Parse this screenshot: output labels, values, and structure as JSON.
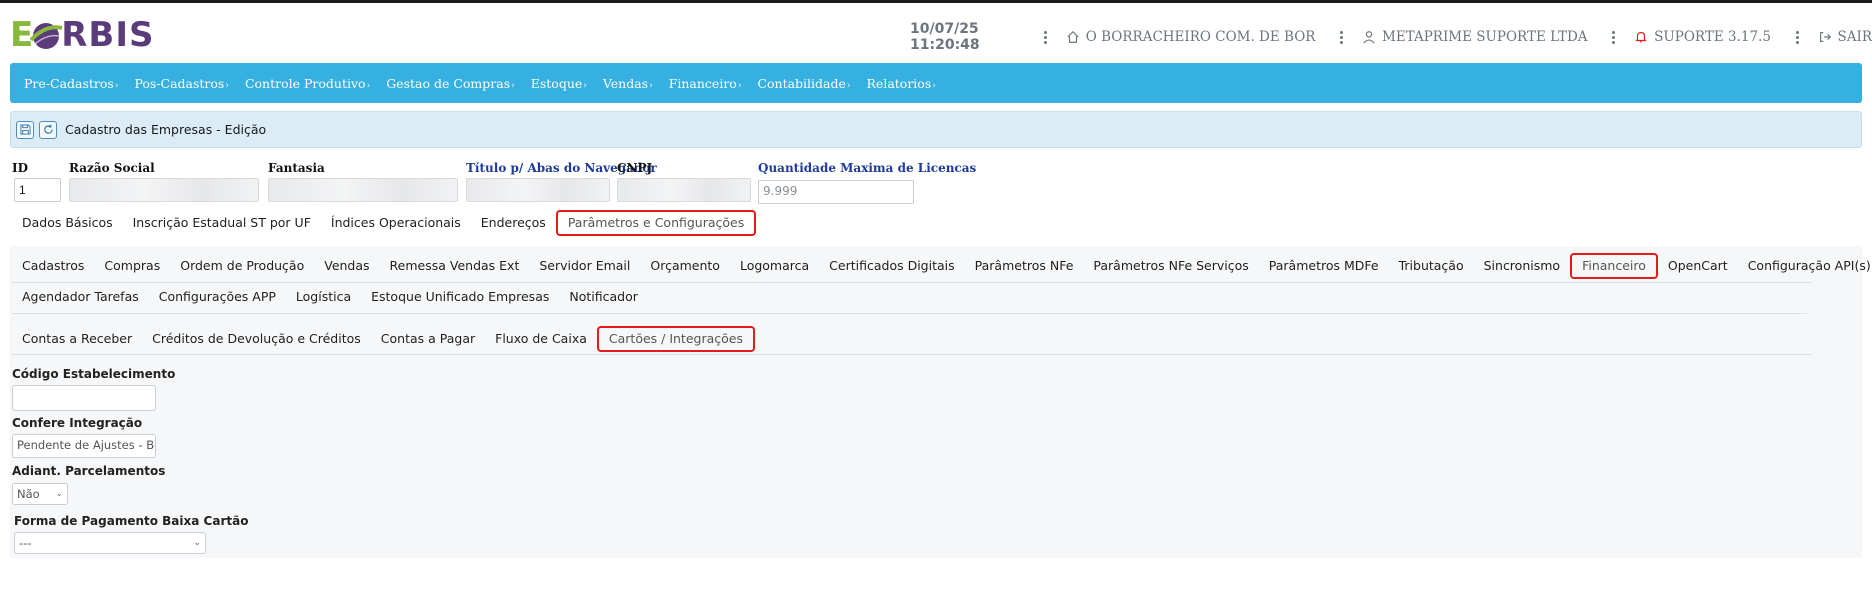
{
  "header": {
    "logo_letters": {
      "first": "E",
      "rest": "RBIS"
    },
    "datetime": "10/07/25 11:20:48",
    "company": "O BORRACHEIRO COM. DE BOR",
    "user": "METAPRIME SUPORTE LTDA",
    "support": "SUPORTE 3.17.5",
    "logout": "SAIR"
  },
  "nav": {
    "items": [
      {
        "label": "Pre-Cadastros"
      },
      {
        "label": "Pos-Cadastros"
      },
      {
        "label": "Controle Produtivo"
      },
      {
        "label": "Gestao de Compras"
      },
      {
        "label": "Estoque"
      },
      {
        "label": "Vendas"
      },
      {
        "label": "Financeiro"
      },
      {
        "label": "Contabilidade"
      },
      {
        "label": "Relatorios"
      }
    ],
    "caret": "›"
  },
  "page": {
    "title": "Cadastro das Empresas - Edição"
  },
  "fields": {
    "id": {
      "label": "ID",
      "value": "1"
    },
    "razao": {
      "label": "Razão Social",
      "value": ""
    },
    "fantasia": {
      "label": "Fantasia",
      "value": ""
    },
    "titulo": {
      "label": "Título p/ Abas do Navegador",
      "value": ""
    },
    "cnpj": {
      "label": "CNPJ",
      "value": ""
    },
    "licencas": {
      "label": "Quantidade Maxima de Licencas",
      "value": "9.999"
    }
  },
  "main_tabs": [
    {
      "label": "Dados Básicos"
    },
    {
      "label": "Inscrição Estadual ST por UF"
    },
    {
      "label": "Índices Operacionais"
    },
    {
      "label": "Endereços"
    },
    {
      "label": "Parâmetros e Configurações"
    }
  ],
  "param_tabs_row1": [
    {
      "label": "Cadastros"
    },
    {
      "label": "Compras"
    },
    {
      "label": "Ordem de Produção"
    },
    {
      "label": "Vendas"
    },
    {
      "label": "Remessa Vendas Ext"
    },
    {
      "label": "Servidor Email"
    },
    {
      "label": "Orçamento"
    },
    {
      "label": "Logomarca"
    },
    {
      "label": "Certificados Digitais"
    },
    {
      "label": "Parâmetros NFe"
    },
    {
      "label": "Parâmetros NFe Serviços"
    },
    {
      "label": "Parâmetros MDFe"
    },
    {
      "label": "Tributação"
    },
    {
      "label": "Sincronismo"
    },
    {
      "label": "Financeiro"
    },
    {
      "label": "OpenCart"
    },
    {
      "label": "Configuração API(s)"
    }
  ],
  "param_tabs_row2": [
    {
      "label": "Agendador Tarefas"
    },
    {
      "label": "Configurações APP"
    },
    {
      "label": "Logística"
    },
    {
      "label": "Estoque Unificado Empresas"
    },
    {
      "label": "Notificador"
    }
  ],
  "fin_tabs": [
    {
      "label": "Contas a Receber"
    },
    {
      "label": "Créditos de Devolução e Créditos"
    },
    {
      "label": "Contas a Pagar"
    },
    {
      "label": "Fluxo de Caixa"
    },
    {
      "label": "Cartões / Integrações"
    }
  ],
  "form": {
    "codigo": {
      "label": "Código Estabelecimento",
      "value": ""
    },
    "confere": {
      "label": "Confere Integração",
      "value": "Pendente de Ajustes - Be"
    },
    "adiant": {
      "label": "Adiant. Parcelamentos",
      "value": "Não"
    },
    "forma": {
      "label": "Forma de Pagamento Baixa Cartão",
      "value": "---"
    }
  },
  "colors": {
    "nav": "#36b0e0",
    "highlight": "#e21b1b",
    "logo_green": "#8ab83c",
    "logo_purple": "#5b3b7a",
    "titlebar": "#dbecf7"
  }
}
